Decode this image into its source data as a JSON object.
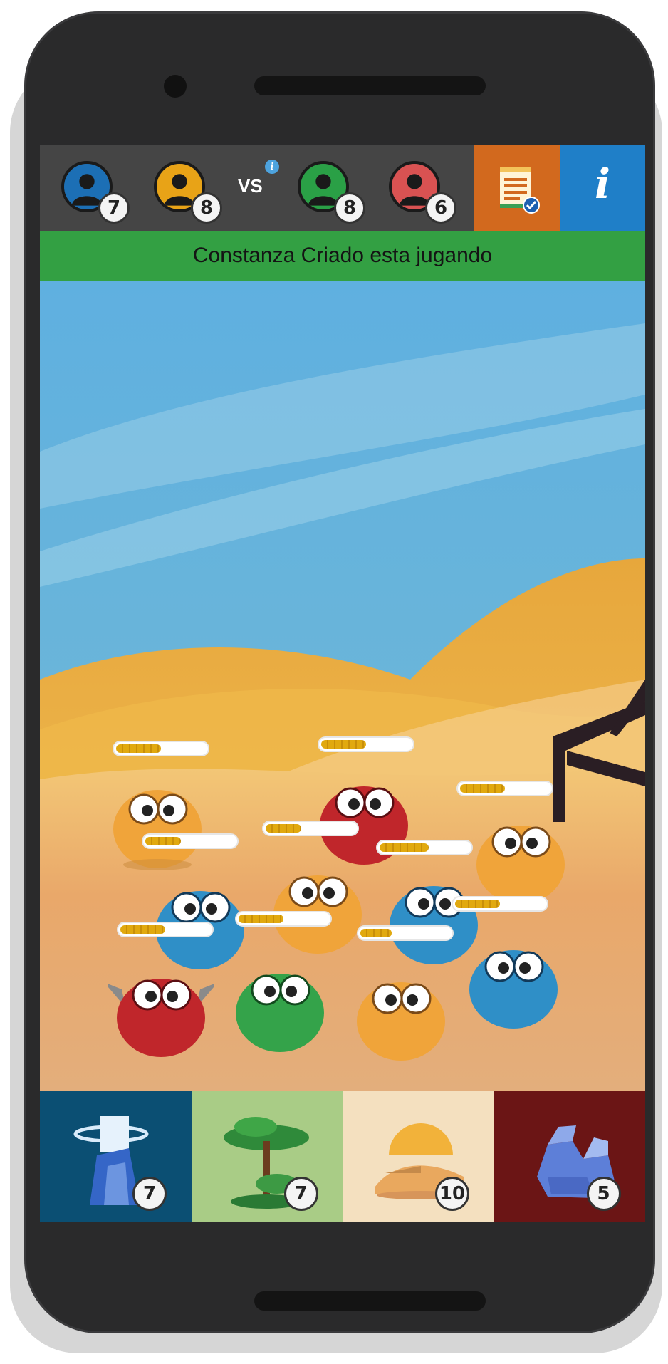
{
  "header": {
    "players": [
      {
        "color": "#1c6fb5",
        "count": "7"
      },
      {
        "color": "#e8a317",
        "count": "8"
      },
      {
        "color": "#2aa046",
        "count": "8"
      },
      {
        "color": "#d95252",
        "count": "6"
      }
    ],
    "vs_label": "VS",
    "vs_info_icon": "info-icon",
    "list_button_icon": "checklist-icon",
    "info_button_label": "i"
  },
  "status": {
    "text": "Constanza Criado esta jugando",
    "color": "#33a043"
  },
  "scene": {
    "background": "desert",
    "monsters": [
      {
        "color": "orange",
        "health": 0.5
      },
      {
        "color": "red",
        "health": 0.5
      },
      {
        "color": "orange",
        "health": 0.4
      },
      {
        "color": "blue",
        "health": 0.4
      },
      {
        "color": "orange",
        "health": 0.5
      },
      {
        "color": "blue",
        "health": 0.55
      },
      {
        "color": "red",
        "health": 0.5
      },
      {
        "color": "green",
        "health": 0.5
      },
      {
        "color": "orange",
        "health": 0.35
      },
      {
        "color": "blue",
        "health": 0.5
      }
    ]
  },
  "tiles": [
    {
      "name": "ice-tower-icon",
      "count": "7",
      "bg": "#0b4f73"
    },
    {
      "name": "jungle-tree-icon",
      "count": "7",
      "bg": "#a9cc86"
    },
    {
      "name": "desert-dune-icon",
      "count": "10",
      "bg": "#f4e0bf"
    },
    {
      "name": "crystal-rocks-icon",
      "count": "5",
      "bg": "#6b1515"
    }
  ]
}
